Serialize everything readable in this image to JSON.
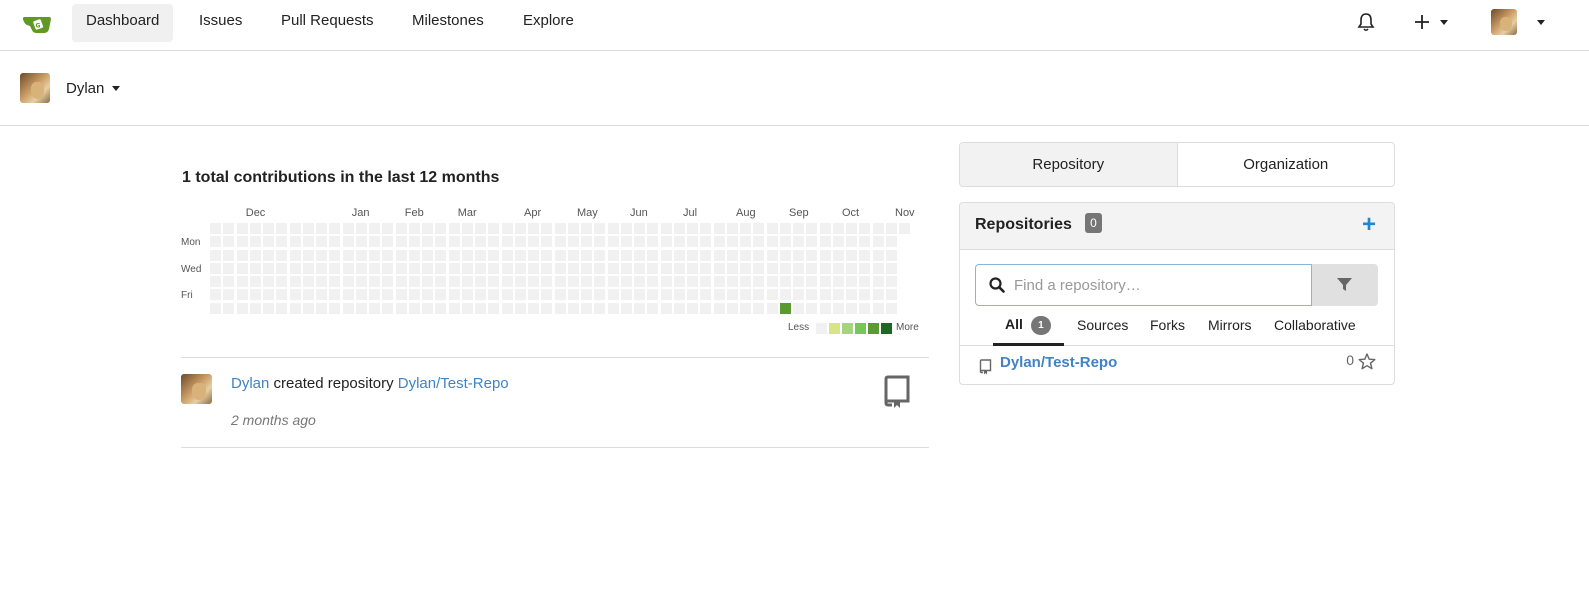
{
  "nav": {
    "items": [
      {
        "label": "Dashboard",
        "active": true
      },
      {
        "label": "Issues"
      },
      {
        "label": "Pull Requests"
      },
      {
        "label": "Milestones"
      },
      {
        "label": "Explore"
      }
    ],
    "icons": [
      "bell-icon",
      "plus-icon",
      "user-avatar"
    ]
  },
  "context_user": {
    "name": "Dylan"
  },
  "heatmap": {
    "title": "1 total contributions in the last 12 months",
    "months": [
      "Dec",
      "Jan",
      "Feb",
      "Mar",
      "Apr",
      "May",
      "Jun",
      "Jul",
      "Aug",
      "Sep",
      "Oct",
      "Nov"
    ],
    "days": [
      "Mon",
      "Wed",
      "Fri"
    ],
    "legend_less": "Less",
    "legend_more": "More",
    "colors": [
      "#f1f1f1",
      "#d6e685",
      "#a6d47a",
      "#78c653",
      "#5a9a2f",
      "#1e6823"
    ],
    "active_color": "#5a9a2f",
    "contributions": [
      {
        "month": "Sep",
        "weekday": "Sat",
        "count": 1
      }
    ]
  },
  "feed": {
    "actor": "Dylan",
    "action": "created repository",
    "repo": "Dylan/Test-Repo",
    "time": "2 months ago"
  },
  "dashboard_tabs": {
    "repository": "Repository",
    "organization": "Organization"
  },
  "repos": {
    "title": "Repositories",
    "count": "0",
    "search_placeholder": "Find a repository…",
    "filter_tabs": {
      "all": "All",
      "all_count": "1",
      "sources": "Sources",
      "forks": "Forks",
      "mirrors": "Mirrors",
      "collaborative": "Collaborative"
    },
    "items": [
      {
        "owner": "Dylan",
        "name": "Test-Repo",
        "stars": "0"
      }
    ]
  },
  "accent_color": "#4183c4"
}
